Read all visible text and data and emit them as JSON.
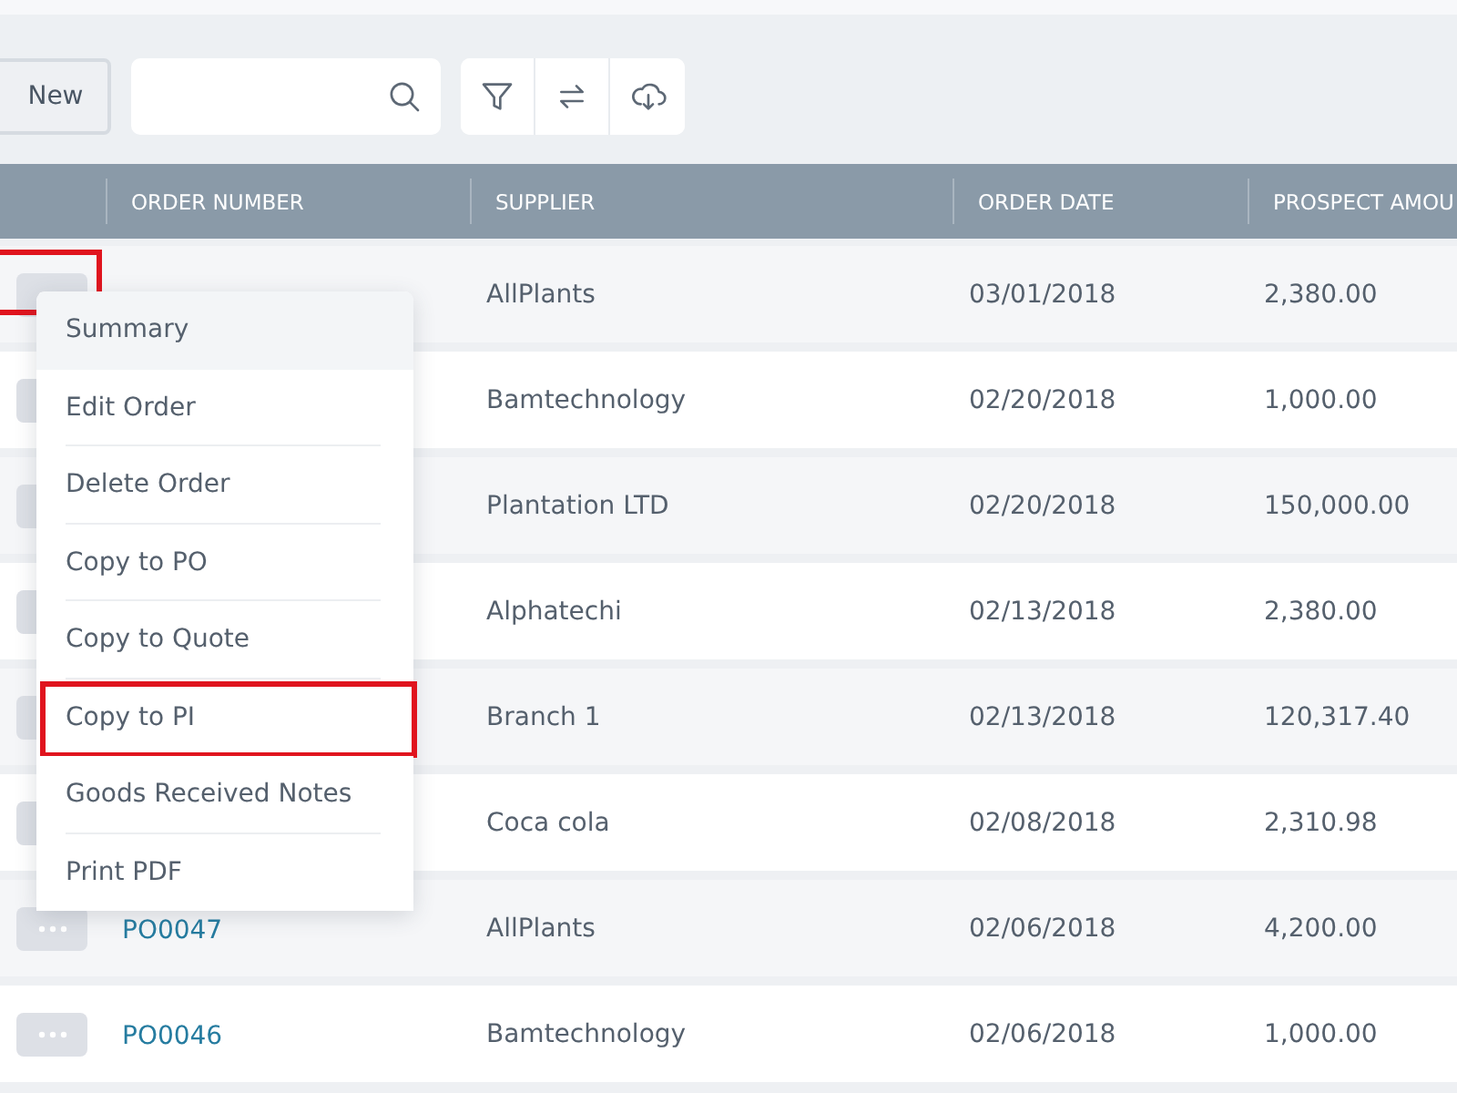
{
  "toolbar": {
    "new_button": "New"
  },
  "table": {
    "columns": [
      "",
      "ORDER NUMBER",
      "SUPPLIER",
      "ORDER DATE",
      "PROSPECT AMOU"
    ],
    "rows": [
      {
        "supplier": "AllPlants",
        "order_date": "03/01/2018",
        "amount": "2,380.00",
        "highlighted": true
      },
      {
        "supplier": "Bamtechnology",
        "order_date": "02/20/2018",
        "amount": "1,000.00",
        "highlighted": false
      },
      {
        "supplier": "Plantation LTD",
        "order_date": "02/20/2018",
        "amount": "150,000.00",
        "highlighted": false
      },
      {
        "supplier": "Alphatechi",
        "order_date": "02/13/2018",
        "amount": "2,380.00",
        "highlighted": false
      },
      {
        "supplier": "Branch 1",
        "order_date": "02/13/2018",
        "amount": "120,317.40",
        "highlighted": false
      },
      {
        "supplier": "Coca cola",
        "order_date": "02/08/2018",
        "amount": "2,310.98",
        "highlighted": false
      },
      {
        "order_number": "PO0047",
        "supplier": "AllPlants",
        "order_date": "02/06/2018",
        "amount": "4,200.00",
        "highlighted": false
      },
      {
        "order_number": "PO0046",
        "supplier": "Bamtechnology",
        "order_date": "02/06/2018",
        "amount": "1,000.00",
        "highlighted": false
      }
    ]
  },
  "menu": {
    "items": [
      {
        "label": "Summary",
        "selected": true,
        "highlighted": false
      },
      {
        "label": "Edit Order",
        "selected": false,
        "highlighted": false
      },
      {
        "label": "Delete Order",
        "selected": false,
        "highlighted": false
      },
      {
        "label": "Copy to PO",
        "selected": false,
        "highlighted": false
      },
      {
        "label": "Copy to Quote",
        "selected": false,
        "highlighted": false
      },
      {
        "label": "Copy to PI",
        "selected": false,
        "highlighted": true
      },
      {
        "label": "Goods Received Notes",
        "selected": false,
        "highlighted": false
      },
      {
        "label": "Print PDF",
        "selected": false,
        "highlighted": false
      }
    ]
  }
}
